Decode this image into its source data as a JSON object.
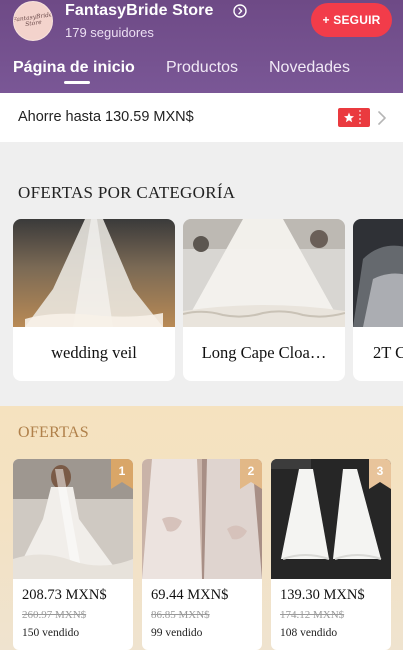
{
  "store": {
    "logo_text": "FantasyBride Store",
    "name": "FantasyBride Store",
    "followers": "179 seguidores",
    "follow_label": "+ SEGUIR"
  },
  "tabs": [
    {
      "label": "Página de inicio",
      "active": true
    },
    {
      "label": "Productos",
      "active": false
    },
    {
      "label": "Novedades",
      "active": false
    }
  ],
  "savings": {
    "text": "Ahorre hasta 130.59 MXN$"
  },
  "categories": {
    "title": "OFERTAS POR CATEGORÍA",
    "items": [
      {
        "label": "wedding veil"
      },
      {
        "label": "Long Cape Cloa…"
      },
      {
        "label": "2T C"
      }
    ]
  },
  "deals": {
    "title": "OFERTAS",
    "items": [
      {
        "rank": "1",
        "price": "208.73 MXN$",
        "old_price": "260.97 MXN$",
        "sold": "150 vendido"
      },
      {
        "rank": "2",
        "price": "69.44 MXN$",
        "old_price": "86.85 MXN$",
        "sold": "99 vendido"
      },
      {
        "rank": "3",
        "price": "139.30 MXN$",
        "old_price": "174.12 MXN$",
        "sold": "108 vendido"
      }
    ]
  },
  "colors": {
    "header": "#7a5796",
    "follow_button": "#f23c4a",
    "deals_title": "#b0804a",
    "rank_badge": "#d9a668"
  },
  "icons": [
    "info-icon",
    "coupon-icon",
    "chevron-right-icon"
  ]
}
